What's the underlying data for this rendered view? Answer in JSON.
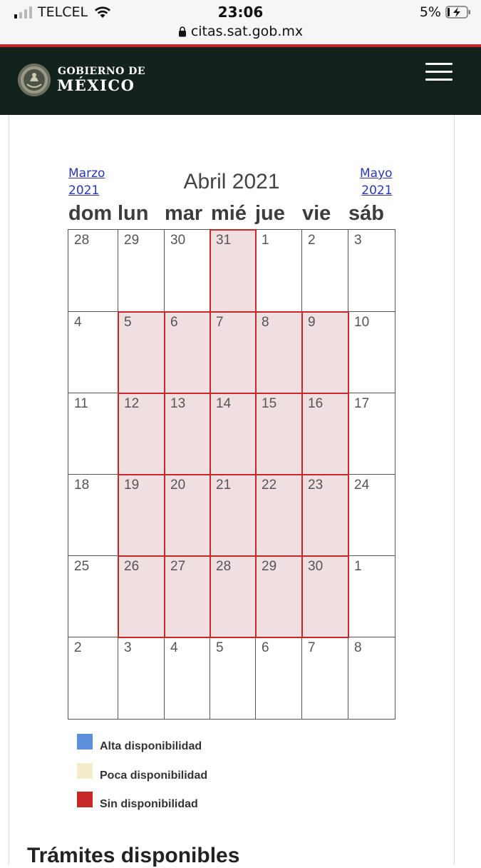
{
  "status_bar": {
    "carrier": "TELCEL",
    "time": "23:06",
    "battery": "5%",
    "url": "citas.sat.gob.mx",
    "signal_bars": 4,
    "signal_active_bars": 1
  },
  "header": {
    "brand_top": "GOBIERNO DE",
    "brand_bottom": "MÉXICO",
    "seal_text": "ESTADOS UNIDOS MEXICANOS",
    "background": "#13221c",
    "accent": "#c4282e"
  },
  "calendar": {
    "month_title": "Abril 2021",
    "prev_month": [
      "Marzo",
      "2021"
    ],
    "next_month": [
      "Mayo",
      "2021"
    ],
    "day_names": [
      "dom",
      "lun",
      "mar",
      "mié",
      "jue",
      "vie",
      "sáb"
    ],
    "weeks": [
      [
        {
          "d": "28",
          "busy": false
        },
        {
          "d": "29",
          "busy": false
        },
        {
          "d": "30",
          "busy": false
        },
        {
          "d": "31",
          "busy": true
        },
        {
          "d": "1",
          "busy": false
        },
        {
          "d": "2",
          "busy": false
        },
        {
          "d": "3",
          "busy": false
        }
      ],
      [
        {
          "d": "4",
          "busy": false
        },
        {
          "d": "5",
          "busy": true
        },
        {
          "d": "6",
          "busy": true
        },
        {
          "d": "7",
          "busy": true
        },
        {
          "d": "8",
          "busy": true
        },
        {
          "d": "9",
          "busy": true
        },
        {
          "d": "10",
          "busy": false
        }
      ],
      [
        {
          "d": "11",
          "busy": false
        },
        {
          "d": "12",
          "busy": true
        },
        {
          "d": "13",
          "busy": true
        },
        {
          "d": "14",
          "busy": true
        },
        {
          "d": "15",
          "busy": true
        },
        {
          "d": "16",
          "busy": true
        },
        {
          "d": "17",
          "busy": false
        }
      ],
      [
        {
          "d": "18",
          "busy": false
        },
        {
          "d": "19",
          "busy": true
        },
        {
          "d": "20",
          "busy": true
        },
        {
          "d": "21",
          "busy": true
        },
        {
          "d": "22",
          "busy": true
        },
        {
          "d": "23",
          "busy": true
        },
        {
          "d": "24",
          "busy": false
        }
      ],
      [
        {
          "d": "25",
          "busy": false
        },
        {
          "d": "26",
          "busy": true
        },
        {
          "d": "27",
          "busy": true
        },
        {
          "d": "28",
          "busy": true
        },
        {
          "d": "29",
          "busy": true
        },
        {
          "d": "30",
          "busy": true
        },
        {
          "d": "1",
          "busy": false
        }
      ],
      [
        {
          "d": "2",
          "busy": false
        },
        {
          "d": "3",
          "busy": false
        },
        {
          "d": "4",
          "busy": false
        },
        {
          "d": "5",
          "busy": false
        },
        {
          "d": "6",
          "busy": false
        },
        {
          "d": "7",
          "busy": false
        },
        {
          "d": "8",
          "busy": false
        }
      ]
    ]
  },
  "legend": [
    {
      "label": "Alta disponibilidad",
      "color": "#5b8fdc"
    },
    {
      "label": "Poca disponibilidad",
      "color": "#f5ebcd"
    },
    {
      "label": "Sin disponibilidad",
      "color": "#c62828"
    }
  ],
  "bottom_heading": "Trámites disponibles"
}
